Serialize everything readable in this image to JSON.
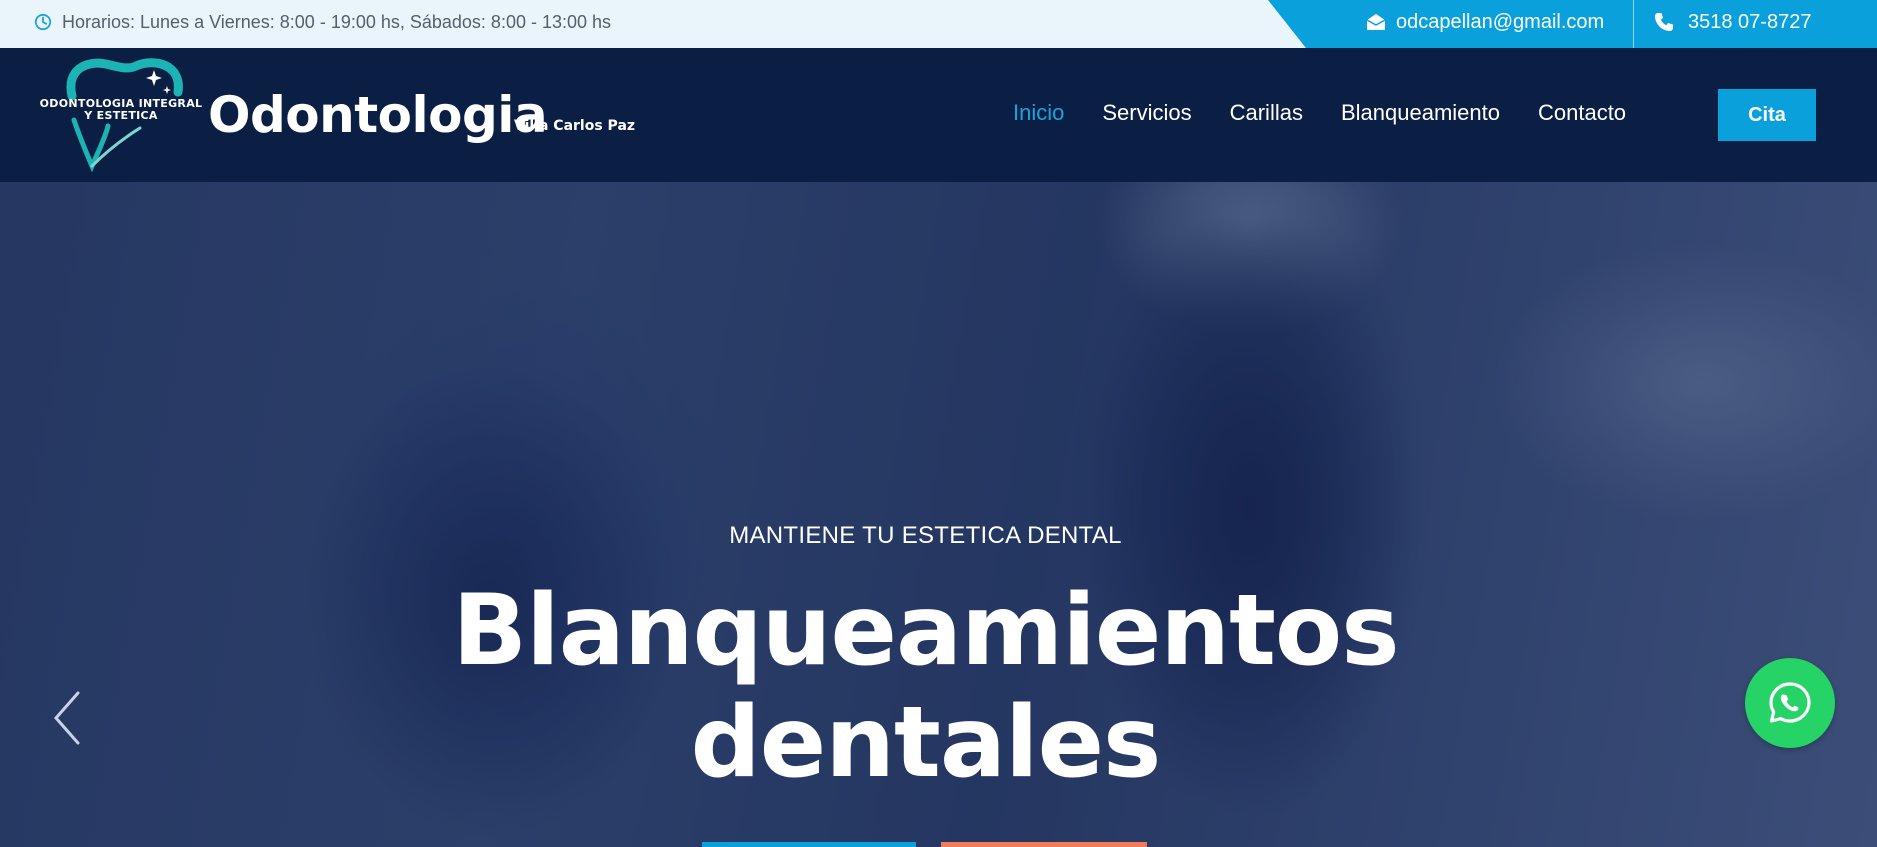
{
  "topbar": {
    "hours_text": "Horarios: Lunes a Viernes: 8:00 - 19:00 hs, Sábados: 8:00 - 13:00 hs",
    "email": "odcapellan@gmail.com",
    "phone": "3518 07-8727"
  },
  "header": {
    "logo_line1": "ODONTOLOGIA INTEGRAL",
    "logo_line2": "Y ESTETICA",
    "brand": "Odontologia",
    "brand_sub": "Villa Carlos Paz",
    "nav": [
      {
        "label": "Inicio",
        "active": true
      },
      {
        "label": "Servicios",
        "active": false
      },
      {
        "label": "Carillas",
        "active": false
      },
      {
        "label": "Blanqueamiento",
        "active": false
      },
      {
        "label": "Contacto",
        "active": false
      }
    ],
    "cta_label": "Cita"
  },
  "hero": {
    "subtitle": "MANTIENE TU ESTETICA DENTAL",
    "title_line1": "Blanqueamientos",
    "title_line2": "dentales"
  },
  "colors": {
    "navy": "#0b1f45",
    "accent_blue": "#0aa0dc",
    "accent_coral": "#f07c5c",
    "whatsapp_green": "#25d366",
    "topbar_bg": "#eaf5fb"
  },
  "icons": [
    "clock-icon",
    "envelope-icon",
    "phone-icon",
    "tooth-logo-icon",
    "chevron-left-icon",
    "whatsapp-icon"
  ]
}
